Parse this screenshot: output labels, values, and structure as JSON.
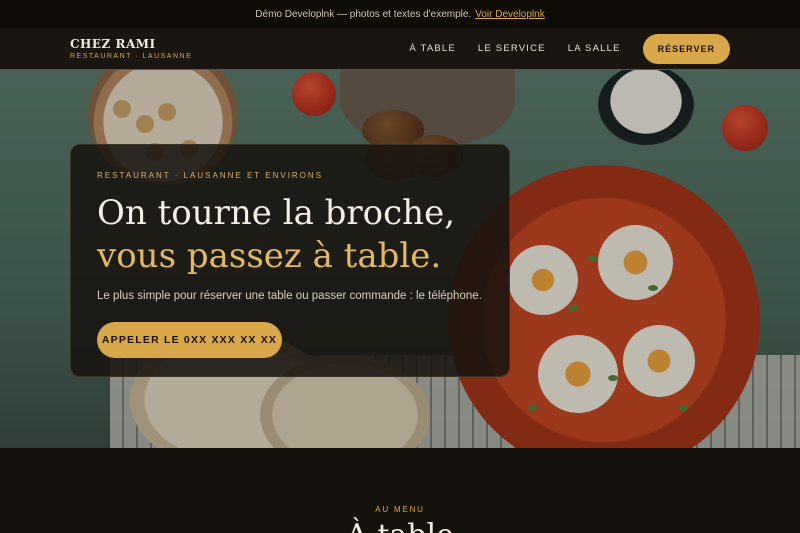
{
  "topbar": {
    "notice": "Démo Developlnk — photos et textes d'exemple.",
    "link": "Voir Developlnk"
  },
  "navbar": {
    "brand_name": "CHEZ RAMI",
    "brand_sub": "RESTAURANT · LAUSANNE",
    "links": [
      "À TABLE",
      "LE SERVICE",
      "LA SALLE"
    ],
    "cta": "RÉSERVER"
  },
  "hero": {
    "eyebrow": "RESTAURANT · LAUSANNE ET ENVIRONS",
    "headline_line1": "On tourne la broche,",
    "headline_line2": "vous passez à table.",
    "subtitle": "Le plus simple pour réserver une table ou passer commande : le téléphone.",
    "call_button": "APPELER LE 0XX XXX XX XX"
  },
  "menu": {
    "eyebrow": "AU MENU",
    "title": "À table"
  },
  "colors": {
    "accent": "#d9a84a",
    "background": "#14100b",
    "headline_accent": "#e4b86a"
  }
}
